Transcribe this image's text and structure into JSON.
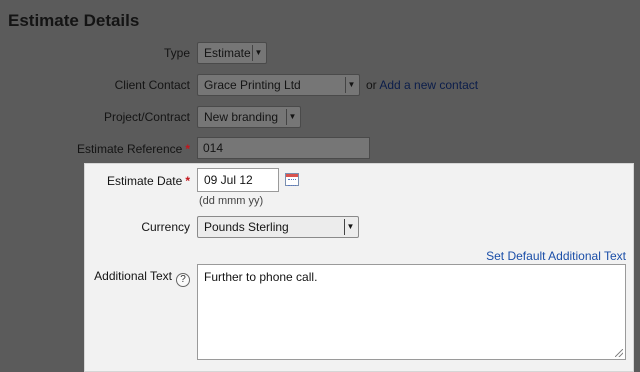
{
  "page_title": "Estimate Details",
  "type": {
    "label": "Type",
    "value": "Estimate"
  },
  "client_contact": {
    "label": "Client Contact",
    "value": "Grace Printing Ltd",
    "or_text": "or",
    "add_link": "Add a new contact"
  },
  "project": {
    "label": "Project/Contract",
    "value": "New branding"
  },
  "reference": {
    "label": "Estimate Reference",
    "required_mark": "*",
    "value": "014"
  },
  "estimate_date": {
    "label": "Estimate Date",
    "required_mark": "*",
    "value": "09 Jul 12",
    "hint": "(dd mmm yy)",
    "icon": "calendar-icon"
  },
  "currency": {
    "label": "Currency",
    "value": "Pounds Sterling"
  },
  "additional_text": {
    "label": "Additional Text",
    "help_glyph": "?",
    "set_default_link": "Set Default Additional Text",
    "value": "Further to phone call."
  },
  "colors": {
    "accent_link": "#1a4ea8",
    "required": "#c4151c",
    "overlay": "#5b5b5b",
    "panel": "#f2f2f2"
  }
}
